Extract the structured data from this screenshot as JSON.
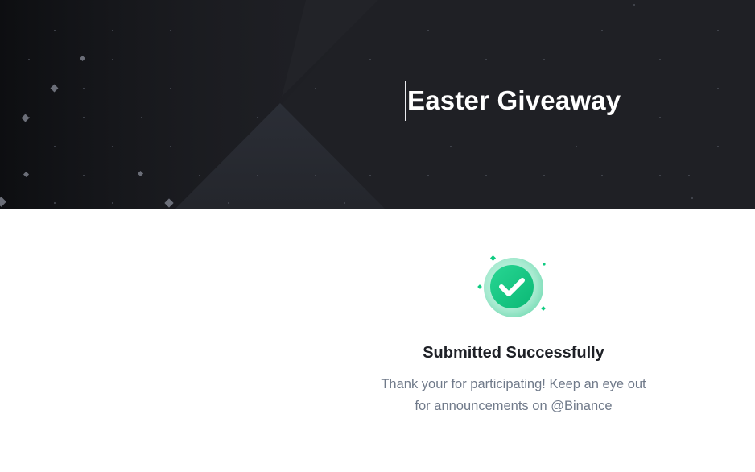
{
  "hero": {
    "title": "Easter Giveaway"
  },
  "result": {
    "title": "Submitted Successfully",
    "message": "Thank your for participating! Keep an eye out for announcements on @Binance"
  },
  "icons": {
    "success": "check-circle-icon"
  },
  "colors": {
    "hero_background": "#1e1f24",
    "success_green": "#0ecb81",
    "title_text": "#1e2026",
    "body_text": "#707a8a"
  }
}
